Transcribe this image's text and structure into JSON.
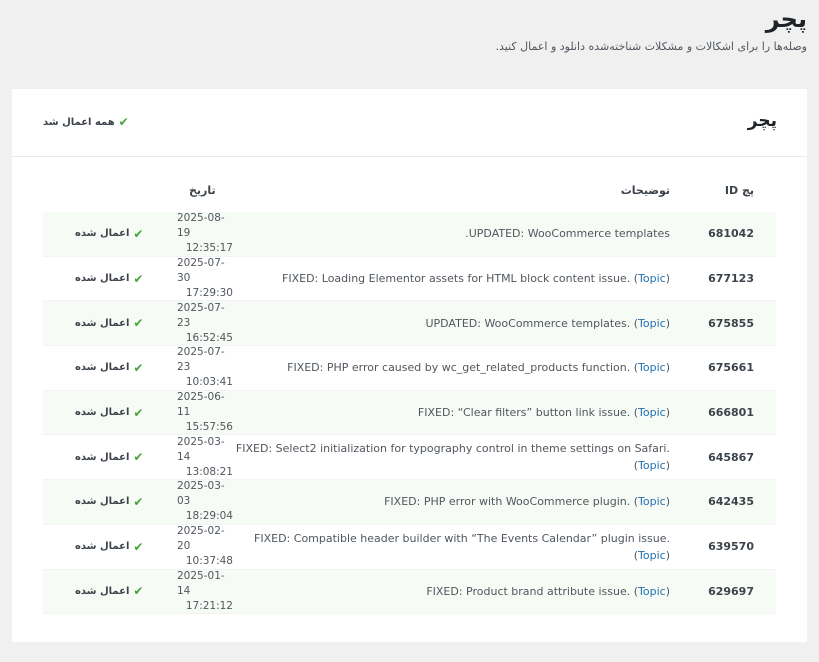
{
  "page": {
    "title": "پچر",
    "description": "وصله‌ها را برای اشکالات و مشکلات شناخته‌شده دانلود و اعمال کنید."
  },
  "card": {
    "title": "پچر",
    "all_applied": "همه اعمال شد"
  },
  "table": {
    "headers": {
      "id": "پچ ID",
      "desc": "توضیحات",
      "date": "تاریخ"
    },
    "topic_label": "Topic",
    "rows": [
      {
        "id": "681042",
        "desc": ".UPDATED: WooCommerce templates",
        "has_topic": false,
        "date": "2025-08-19",
        "time": "12:35:17",
        "status": "اعمال شده"
      },
      {
        "id": "677123",
        "desc": "FIXED: Loading Elementor assets for HTML block content issue.",
        "has_topic": true,
        "date": "2025-07-30",
        "time": "17:29:30",
        "status": "اعمال شده"
      },
      {
        "id": "675855",
        "desc": "UPDATED: WooCommerce templates.",
        "has_topic": true,
        "date": "2025-07-23",
        "time": "16:52:45",
        "status": "اعمال شده"
      },
      {
        "id": "675661",
        "desc": "FIXED: PHP error caused by wc_get_related_products function.",
        "has_topic": true,
        "date": "2025-07-23",
        "time": "10:03:41",
        "status": "اعمال شده"
      },
      {
        "id": "666801",
        "desc": "FIXED: “Clear filters” button link issue.",
        "has_topic": true,
        "date": "2025-06-11",
        "time": "15:57:56",
        "status": "اعمال شده"
      },
      {
        "id": "645867",
        "desc": "FIXED: Select2 initialization for typography control in theme settings on Safari.",
        "has_topic": true,
        "date": "2025-03-14",
        "time": "13:08:21",
        "status": "اعمال شده"
      },
      {
        "id": "642435",
        "desc": "FIXED: PHP error with WooCommerce plugin.",
        "has_topic": true,
        "date": "2025-03-03",
        "time": "18:29:04",
        "status": "اعمال شده"
      },
      {
        "id": "639570",
        "desc": "FIXED: Compatible header builder with “The Events Calendar” plugin issue.",
        "has_topic": true,
        "date": "2025-02-20",
        "time": "10:37:48",
        "status": "اعمال شده"
      },
      {
        "id": "629697",
        "desc": "FIXED: Product brand attribute issue.",
        "has_topic": true,
        "date": "2025-01-14",
        "time": "17:21:12",
        "status": "اعمال شده"
      }
    ]
  },
  "colors": {
    "accent_link": "#2271b1",
    "check_green": "#46a33a",
    "row_alt_bg": "#f7fbf6"
  },
  "icons": {
    "status": "check-icon"
  }
}
